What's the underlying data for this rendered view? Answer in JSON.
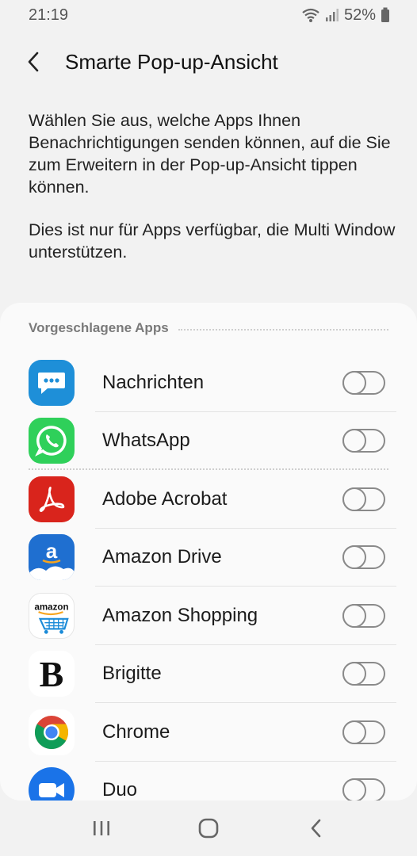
{
  "status_bar": {
    "time": "21:19",
    "battery": "52%"
  },
  "header": {
    "title": "Smarte Pop-up-Ansicht"
  },
  "description": {
    "paragraph1": "Wählen Sie aus, welche Apps Ihnen Benachrichtigungen senden können, auf die Sie zum Erweitern in der Pop-up-Ansicht tippen können.",
    "paragraph2": "Dies ist nur für Apps verfügbar, die Multi Window unterstützen."
  },
  "section": {
    "label": "Vorgeschlagene Apps"
  },
  "apps": [
    {
      "name": "Nachrichten",
      "icon": "messages-icon",
      "enabled": false
    },
    {
      "name": "WhatsApp",
      "icon": "whatsapp-icon",
      "enabled": false
    },
    {
      "name": "Adobe Acrobat",
      "icon": "adobe-acrobat-icon",
      "enabled": false
    },
    {
      "name": "Amazon Drive",
      "icon": "amazon-drive-icon",
      "enabled": false
    },
    {
      "name": "Amazon Shopping",
      "icon": "amazon-shopping-icon",
      "enabled": false
    },
    {
      "name": "Brigitte",
      "icon": "brigitte-icon",
      "enabled": false
    },
    {
      "name": "Chrome",
      "icon": "chrome-icon",
      "enabled": false
    },
    {
      "name": "Duo",
      "icon": "duo-icon",
      "enabled": false
    }
  ],
  "icon_texts": {
    "amazon_drive_letter": "a",
    "amazon_wordmark": "amazon",
    "brigitte_letter": "B"
  },
  "colors": {
    "background": "#f2f2f2",
    "card": "#fafafa",
    "messages_blue": "#1e8fd8",
    "whatsapp_green": "#2fd05a",
    "acrobat_red": "#d9241c",
    "duo_blue": "#1a73e8"
  }
}
